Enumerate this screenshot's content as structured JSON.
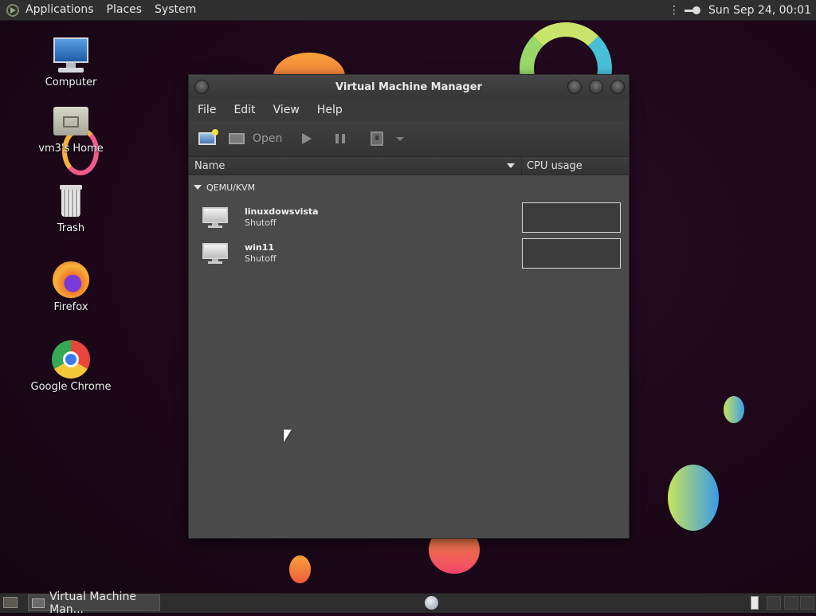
{
  "top_panel": {
    "menus": [
      "Applications",
      "Places",
      "System"
    ],
    "clock": "Sun Sep 24, 00:01"
  },
  "desktop": {
    "icons": [
      {
        "label": "Computer",
        "icon": "computer-icon"
      },
      {
        "label": "vm3's Home",
        "icon": "home-folder-icon"
      },
      {
        "label": "Trash",
        "icon": "trash-icon"
      },
      {
        "label": "Firefox",
        "icon": "firefox-icon"
      },
      {
        "label": "Google Chrome",
        "icon": "chrome-icon"
      }
    ]
  },
  "window": {
    "title": "Virtual Machine Manager",
    "menu": [
      "File",
      "Edit",
      "View",
      "Help"
    ],
    "toolbar": {
      "new_vm": "new-vm-icon",
      "open_icon": "monitor-icon",
      "open_label": "Open",
      "run": "play-icon",
      "pause": "pause-icon",
      "shutdown": "power-icon",
      "more": "dropdown-arrow-icon"
    },
    "columns": {
      "name": "Name",
      "cpu": "CPU usage"
    },
    "group": "QEMU/KVM",
    "vms": [
      {
        "name": "linuxdowsvista",
        "status": "Shutoff"
      },
      {
        "name": "win11",
        "status": "Shutoff"
      }
    ]
  },
  "bottom_panel": {
    "task_label": "Virtual Machine Man..."
  },
  "colors": {
    "desktop_bg": "#1b0718",
    "window_bg": "#4a4a4a",
    "panel_bg": "#2f2f2f"
  }
}
